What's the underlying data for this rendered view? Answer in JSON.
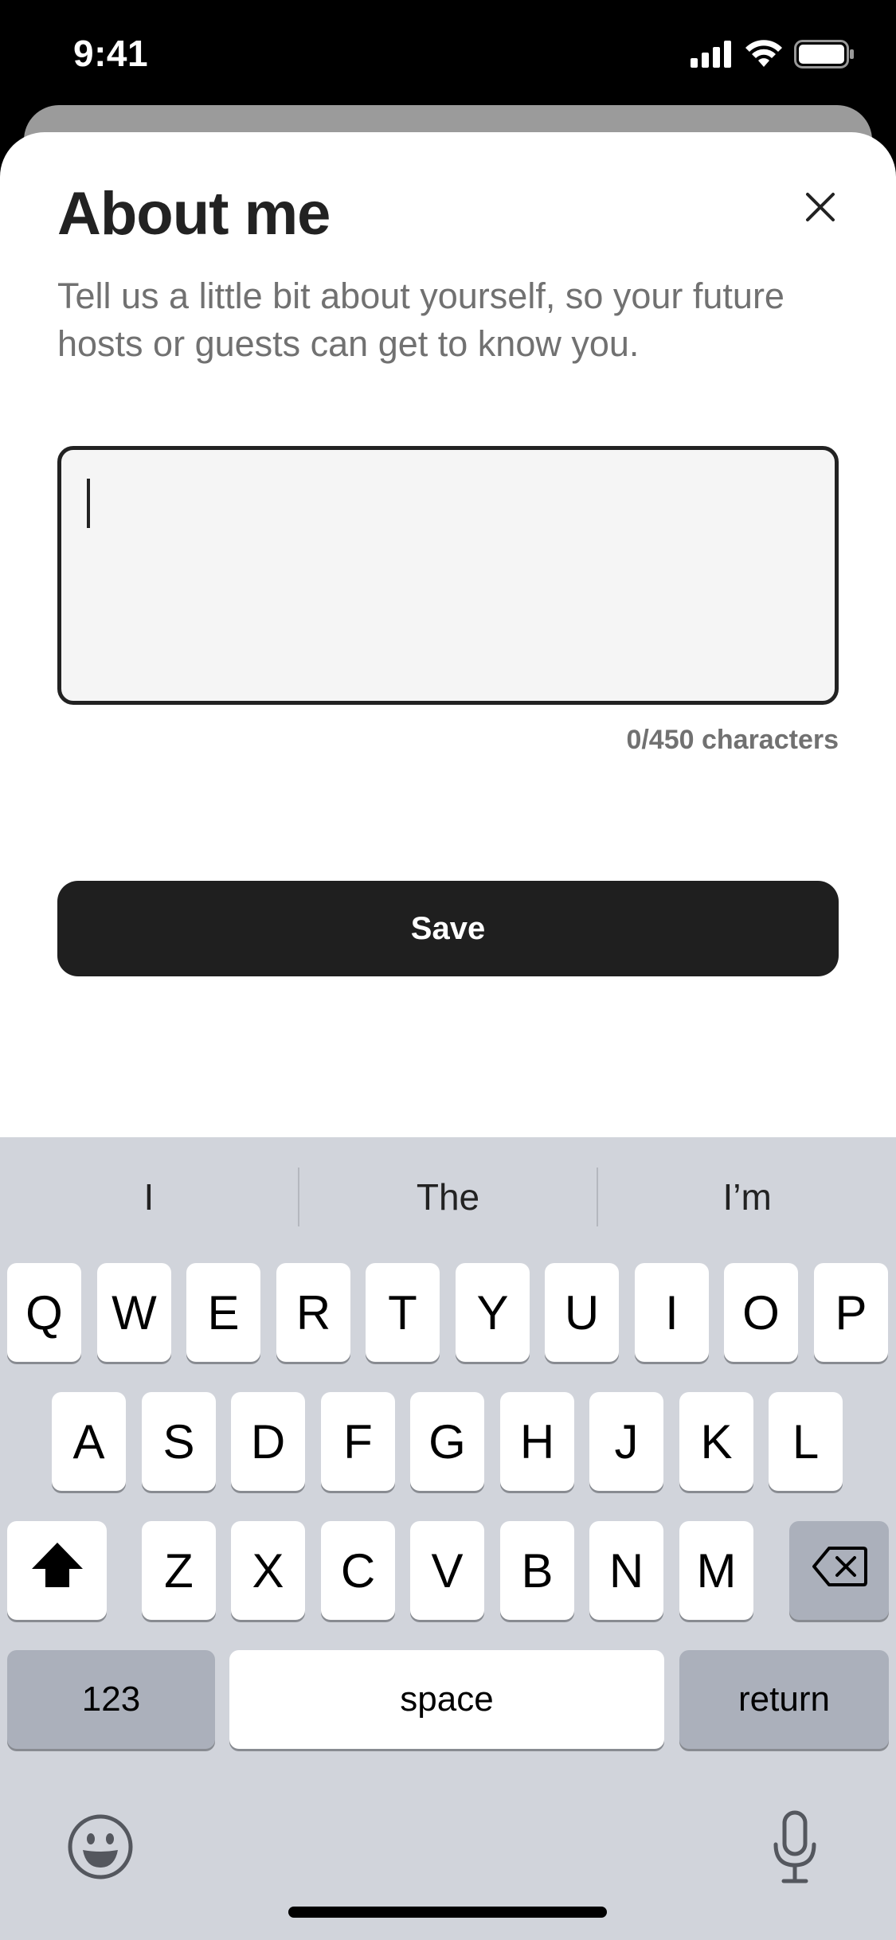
{
  "status_bar": {
    "time": "9:41"
  },
  "modal": {
    "title": "About me",
    "subtitle": "Tell us a little bit about yourself, so your future hosts or guests can get to know you.",
    "textarea_value": "",
    "char_count": "0/450 characters",
    "save_label": "Save"
  },
  "keyboard": {
    "suggestions": [
      "I",
      "The",
      "I’m"
    ],
    "row1": [
      "Q",
      "W",
      "E",
      "R",
      "T",
      "Y",
      "U",
      "I",
      "O",
      "P"
    ],
    "row2": [
      "A",
      "S",
      "D",
      "F",
      "G",
      "H",
      "J",
      "K",
      "L"
    ],
    "row3": [
      "Z",
      "X",
      "C",
      "V",
      "B",
      "N",
      "M"
    ],
    "numbers_label": "123",
    "space_label": "space",
    "return_label": "return"
  },
  "icons": {
    "signal": "cellular-signal-icon",
    "wifi": "wifi-icon",
    "battery": "battery-icon",
    "close": "close-icon",
    "shift": "shift-icon",
    "backspace": "backspace-icon",
    "emoji": "emoji-icon",
    "microphone": "microphone-icon"
  },
  "colors": {
    "primary_button": "#1f1f1f",
    "text_primary": "#222222",
    "text_secondary": "#717171",
    "keyboard_bg": "#d1d4db"
  }
}
